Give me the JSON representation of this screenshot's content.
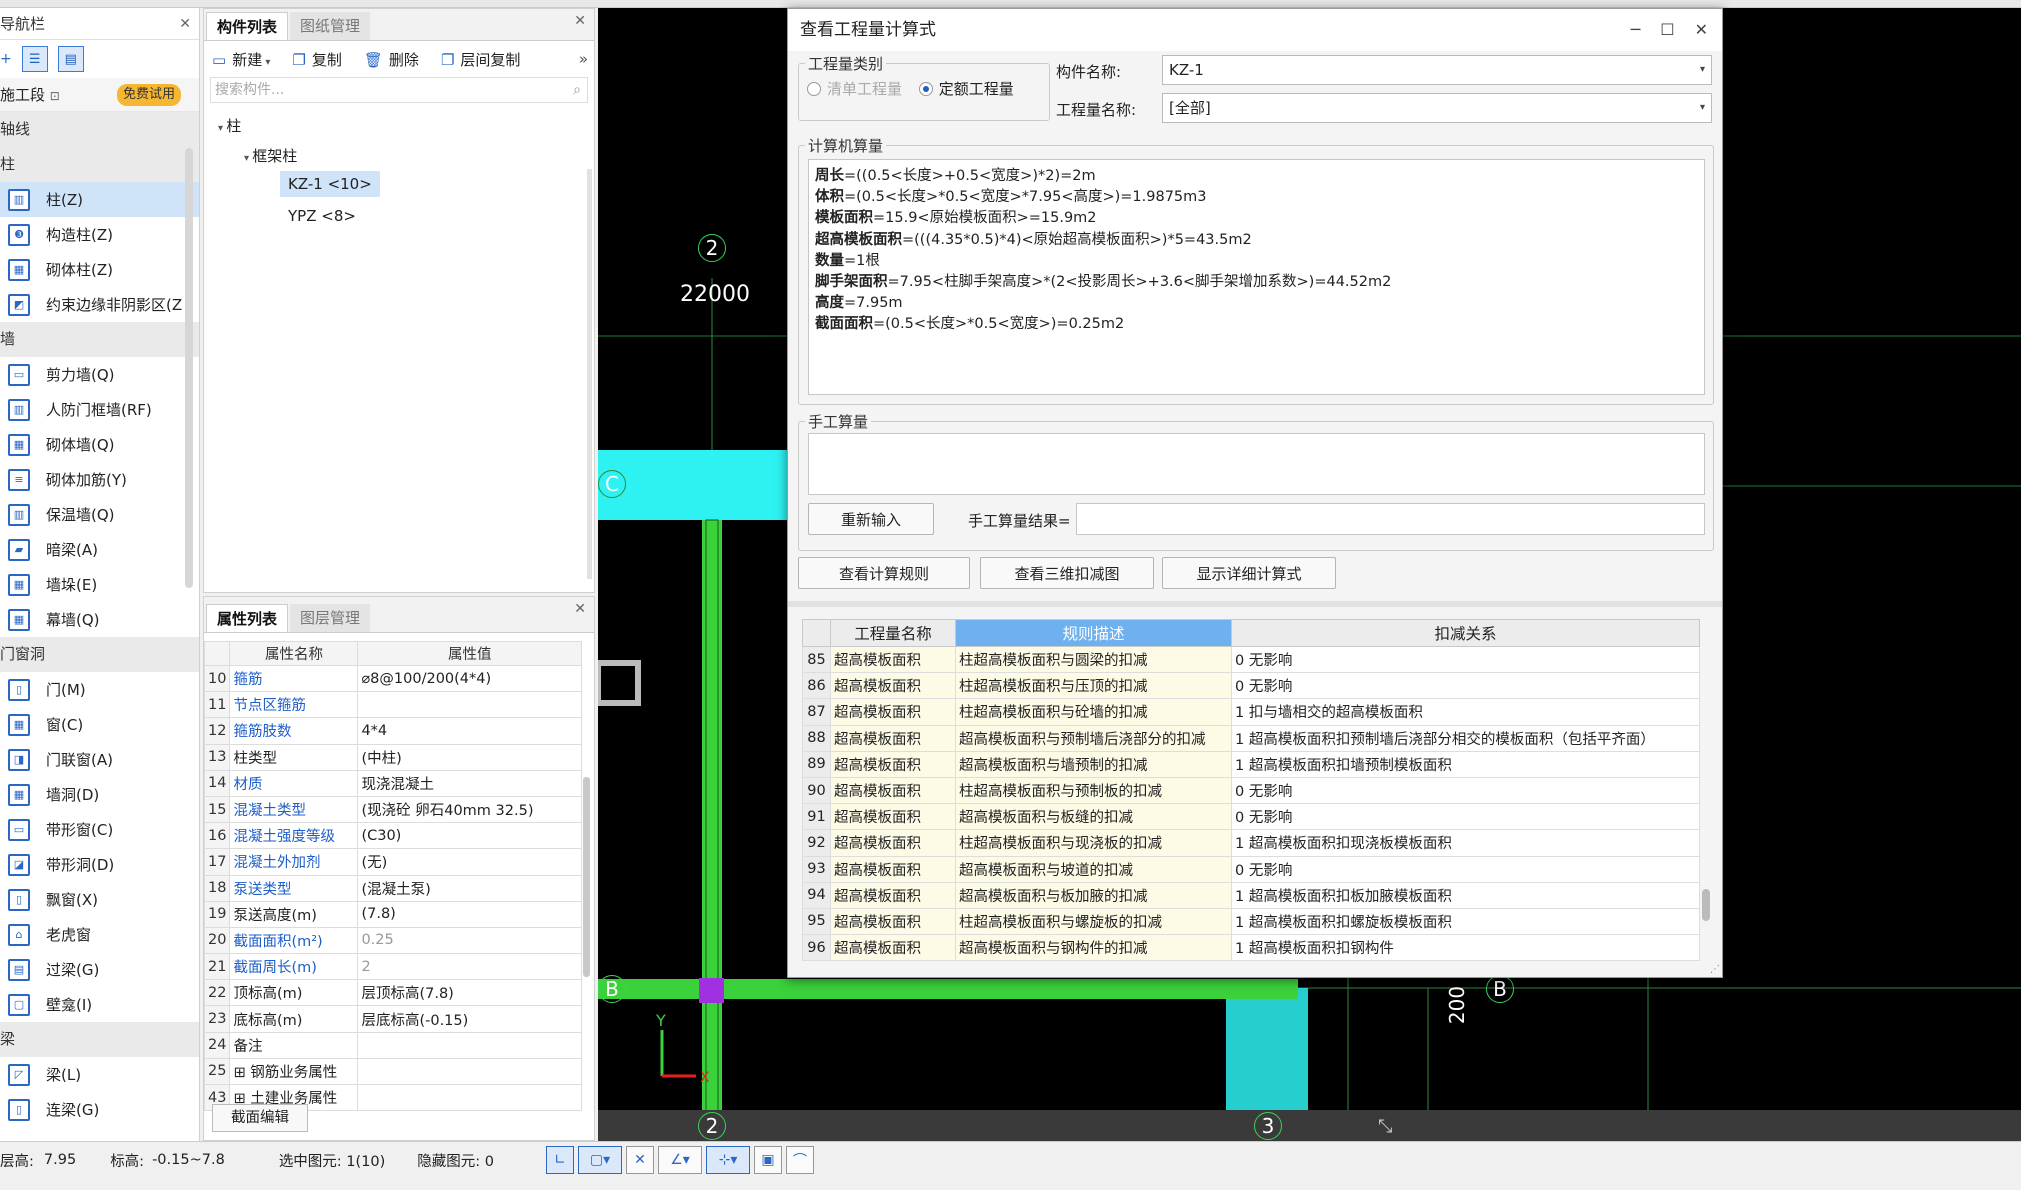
{
  "nav": {
    "title": "导航栏",
    "segment": "施工段",
    "free_badge": "免费试用",
    "cats": {
      "axis": "轴线",
      "column": "柱",
      "wall": "墙",
      "door": "门窗洞",
      "beam": "梁"
    },
    "column_items": [
      "柱(Z)",
      "构造柱(Z)",
      "砌体柱(Z)",
      "约束边缘非阴影区(Z"
    ],
    "wall_items": [
      "剪力墙(Q)",
      "人防门框墙(RF)",
      "砌体墙(Q)",
      "砌体加筋(Y)",
      "保温墙(Q)",
      "暗梁(A)",
      "墙垛(E)",
      "幕墙(Q)"
    ],
    "door_items": [
      "门(M)",
      "窗(C)",
      "门联窗(A)",
      "墙洞(D)",
      "带形窗(C)",
      "带形洞(D)",
      "飘窗(X)",
      "老虎窗",
      "过梁(G)",
      "壁龛(I)"
    ],
    "beam_items": [
      "梁(L)",
      "连梁(G)"
    ]
  },
  "comp": {
    "tab_active": "构件列表",
    "tab_other": "图纸管理",
    "new": "新建",
    "copy": "复制",
    "delete": "删除",
    "floor_copy": "层间复制",
    "search_placeholder": "搜索构件...",
    "tree_root": "柱",
    "tree_group": "框架柱",
    "tree_sel": "KZ-1 <10>",
    "tree_other": "YPZ <8>"
  },
  "props": {
    "tab_active": "属性列表",
    "tab_other": "图层管理",
    "col_name": "属性名称",
    "col_value": "属性值",
    "rows": [
      {
        "n": "10",
        "k": "箍筋",
        "v": "⌀8@100/200(4*4)",
        "blue": true
      },
      {
        "n": "11",
        "k": "节点区箍筋",
        "v": "",
        "blue": true
      },
      {
        "n": "12",
        "k": "箍筋肢数",
        "v": "4*4",
        "blue": true
      },
      {
        "n": "13",
        "k": "柱类型",
        "v": "(中柱)",
        "blue": false
      },
      {
        "n": "14",
        "k": "材质",
        "v": "现浇混凝土",
        "blue": true
      },
      {
        "n": "15",
        "k": "混凝土类型",
        "v": "(现浇砼 卵石40mm 32.5)",
        "blue": true
      },
      {
        "n": "16",
        "k": "混凝土强度等级",
        "v": "(C30)",
        "blue": true
      },
      {
        "n": "17",
        "k": "混凝土外加剂",
        "v": "(无)",
        "blue": true
      },
      {
        "n": "18",
        "k": "泵送类型",
        "v": "(混凝土泵)",
        "blue": true
      },
      {
        "n": "19",
        "k": "泵送高度(m)",
        "v": "(7.8)",
        "blue": false
      },
      {
        "n": "20",
        "k": "截面面积(m²)",
        "v": "0.25",
        "blue": true,
        "gray": true
      },
      {
        "n": "21",
        "k": "截面周长(m)",
        "v": "2",
        "blue": true,
        "gray": true
      },
      {
        "n": "22",
        "k": "顶标高(m)",
        "v": "层顶标高(7.8)",
        "blue": false
      },
      {
        "n": "23",
        "k": "底标高(m)",
        "v": "层底标高(-0.15)",
        "blue": false
      },
      {
        "n": "24",
        "k": "备注",
        "v": "",
        "blue": false
      },
      {
        "n": "25",
        "k": "⊞ 钢筋业务属性",
        "v": "",
        "blue": false
      },
      {
        "n": "43",
        "k": "⊞ 土建业务属性",
        "v": "",
        "blue": false
      }
    ],
    "section_edit": "截面编辑"
  },
  "canvas": {
    "dim": "22000",
    "axis_2": "2",
    "axis_b": "B",
    "axis_c": "C",
    "axis_3": "3",
    "dim2": "200"
  },
  "status": {
    "floor_h_label": "层高:",
    "floor_h": "7.95",
    "elev_label": "标高:",
    "elev": "-0.15~7.8",
    "selected": "选中图元: 1(10)",
    "hidden": "隐藏图元: 0"
  },
  "dialog": {
    "title": "查看工程量计算式",
    "qty_type_legend": "工程量类别",
    "radio_list": "清单工程量",
    "radio_quota": "定额工程量",
    "comp_name_label": "构件名称:",
    "comp_name": "KZ-1",
    "qty_name_label": "工程量名称:",
    "qty_name": "[全部]",
    "computer_legend": "计算机算量",
    "formulas": [
      {
        "k": "周长",
        "v": "=((0.5<长度>+0.5<宽度>)*2)=2m"
      },
      {
        "k": "体积",
        "v": "=(0.5<长度>*0.5<宽度>*7.95<高度>)=1.9875m3"
      },
      {
        "k": "模板面积",
        "v": "=15.9<原始模板面积>=15.9m2"
      },
      {
        "k": "超高模板面积",
        "v": "=(((4.35*0.5)*4)<原始超高模板面积>)*5=43.5m2"
      },
      {
        "k": "数量",
        "v": "=1根"
      },
      {
        "k": "脚手架面积",
        "v": "=7.95<柱脚手架高度>*(2<投影周长>+3.6<脚手架增加系数>)=44.52m2"
      },
      {
        "k": "高度",
        "v": "=7.95m"
      },
      {
        "k": "截面面积",
        "v": "=(0.5<长度>*0.5<宽度>)=0.25m2"
      }
    ],
    "manual_legend": "手工算量",
    "reinput": "重新输入",
    "manual_result_label": "手工算量结果=",
    "btn_rules": "查看计算规则",
    "btn_3d": "查看三维扣减图",
    "btn_detail": "显示详细计算式",
    "table_cols": [
      "工程量名称",
      "规则描述",
      "扣减关系"
    ],
    "rows": [
      {
        "n": "85",
        "a": "超高模板面积",
        "b": "柱超高模板面积与圆梁的扣减",
        "c": "0 无影响"
      },
      {
        "n": "86",
        "a": "超高模板面积",
        "b": "柱超高模板面积与压顶的扣减",
        "c": "0 无影响"
      },
      {
        "n": "87",
        "a": "超高模板面积",
        "b": "柱超高模板面积与砼墙的扣减",
        "c": "1 扣与墙相交的超高模板面积"
      },
      {
        "n": "88",
        "a": "超高模板面积",
        "b": "超高模板面积与预制墙后浇部分的扣减",
        "c": "1 超高模板面积扣预制墙后浇部分相交的模板面积（包括平齐面）"
      },
      {
        "n": "89",
        "a": "超高模板面积",
        "b": "超高模板面积与墙预制的扣减",
        "c": "1 超高模板面积扣墙预制模板面积"
      },
      {
        "n": "90",
        "a": "超高模板面积",
        "b": "柱超高模板面积与预制板的扣减",
        "c": "0 无影响"
      },
      {
        "n": "91",
        "a": "超高模板面积",
        "b": "超高模板面积与板缝的扣减",
        "c": "0 无影响"
      },
      {
        "n": "92",
        "a": "超高模板面积",
        "b": "柱超高模板面积与现浇板的扣减",
        "c": "1 超高模板面积扣现浇板模板面积"
      },
      {
        "n": "93",
        "a": "超高模板面积",
        "b": "超高模板面积与坡道的扣减",
        "c": "0 无影响"
      },
      {
        "n": "94",
        "a": "超高模板面积",
        "b": "超高模板面积与板加腋的扣减",
        "c": "1 超高模板面积扣板加腋模板面积"
      },
      {
        "n": "95",
        "a": "超高模板面积",
        "b": "柱超高模板面积与螺旋板的扣减",
        "c": "1 超高模板面积扣螺旋板模板面积"
      },
      {
        "n": "96",
        "a": "超高模板面积",
        "b": "超高模板面积与钢构件的扣减",
        "c": "1 超高模板面积扣钢构件"
      }
    ]
  },
  "colors": {
    "accent": "#2b67c7",
    "cyan": "#2ef2f2",
    "green": "#3bd13b",
    "highlight": "#6fb0ee",
    "arrow": "#e8201c"
  }
}
